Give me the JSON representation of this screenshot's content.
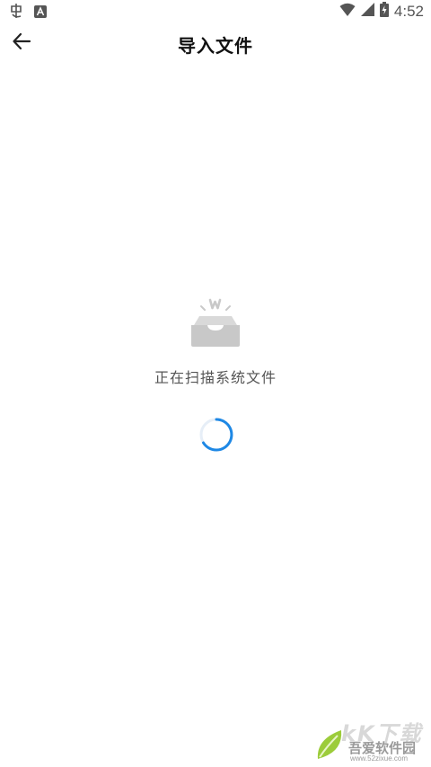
{
  "status_bar": {
    "time": "4:52",
    "left_icons": [
      "notification-app-icon",
      "notification-a-icon"
    ],
    "right_icons": [
      "wifi-icon",
      "cell-signal-icon",
      "battery-charging-icon"
    ]
  },
  "app_bar": {
    "title": "导入文件",
    "back_icon": "arrow-left-icon"
  },
  "main": {
    "empty_icon": "inbox-tray-icon",
    "scan_status": "正在扫描系统文件",
    "loading_progress": "indeterminate",
    "accent_color": "#1e88e5"
  },
  "watermark": {
    "line1": "kK下载",
    "line2": "吾爱软件园",
    "line3": "www.52zixue.com"
  }
}
